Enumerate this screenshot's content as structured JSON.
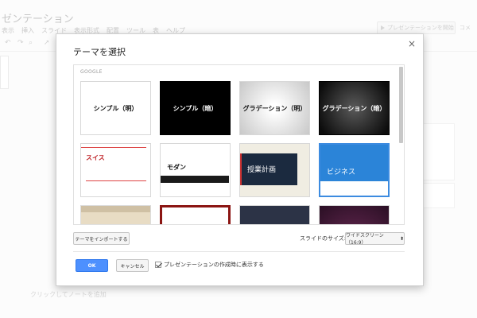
{
  "app": {
    "title": "ゼンテーション",
    "menu": [
      "表示",
      "挿入",
      "スライド",
      "表示形式",
      "配置",
      "ツール",
      "表",
      "ヘルプ"
    ],
    "present_label": "プレゼンテーションを開始",
    "share_label": "コメ",
    "notes_placeholder": "クリックしてノートを追加"
  },
  "dialog": {
    "title": "テーマを選択",
    "close_glyph": "×",
    "section_label": "GOOGLE",
    "themes": [
      {
        "label": "シンプル（明）"
      },
      {
        "label": "シンプル（暗）"
      },
      {
        "label": "グラデーション（明）"
      },
      {
        "label": "グラデーション（暗）"
      },
      {
        "label": "スイス"
      },
      {
        "label": "モダン"
      },
      {
        "label": "授業計画"
      },
      {
        "label": "ビジネス"
      },
      {
        "label": ""
      },
      {
        "label": ""
      },
      {
        "label": ""
      },
      {
        "label": ""
      }
    ],
    "selected_theme": "ビジネス",
    "import_button": "テーマをインポートする",
    "slide_size_label": "スライドのサイズ:",
    "slide_size_value": "ワイドスクリーン（16:9）",
    "ok_button": "OK",
    "cancel_button": "キャンセル",
    "show_on_create_label": "プレゼンテーションの作成時に表示する",
    "show_on_create_checked": true
  },
  "colors": {
    "accent": "#4d90fe",
    "business_blue": "#2b84d8",
    "swiss_red": "#c0262b"
  }
}
